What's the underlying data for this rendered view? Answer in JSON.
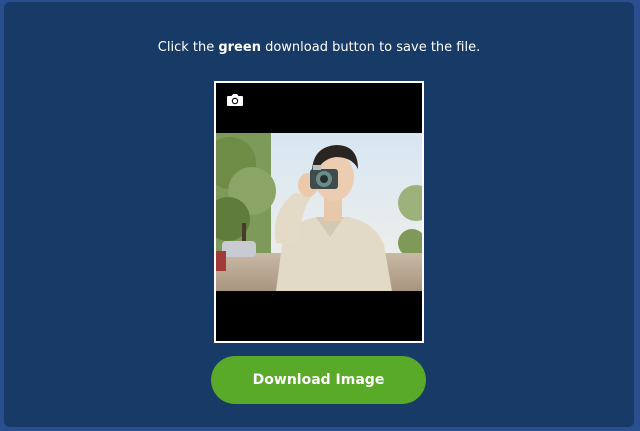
{
  "instruction": {
    "prefix": "Click the ",
    "emphasis": "green",
    "suffix": " download button to save the file."
  },
  "preview": {
    "icon": "camera-icon",
    "photo_subject": "photo-man-with-camera"
  },
  "download_button": {
    "label": "Download Image",
    "color": "#5aaa2a"
  },
  "colors": {
    "background": "#2a4f8f",
    "panel": "#173a67",
    "text": "#ffffff"
  }
}
